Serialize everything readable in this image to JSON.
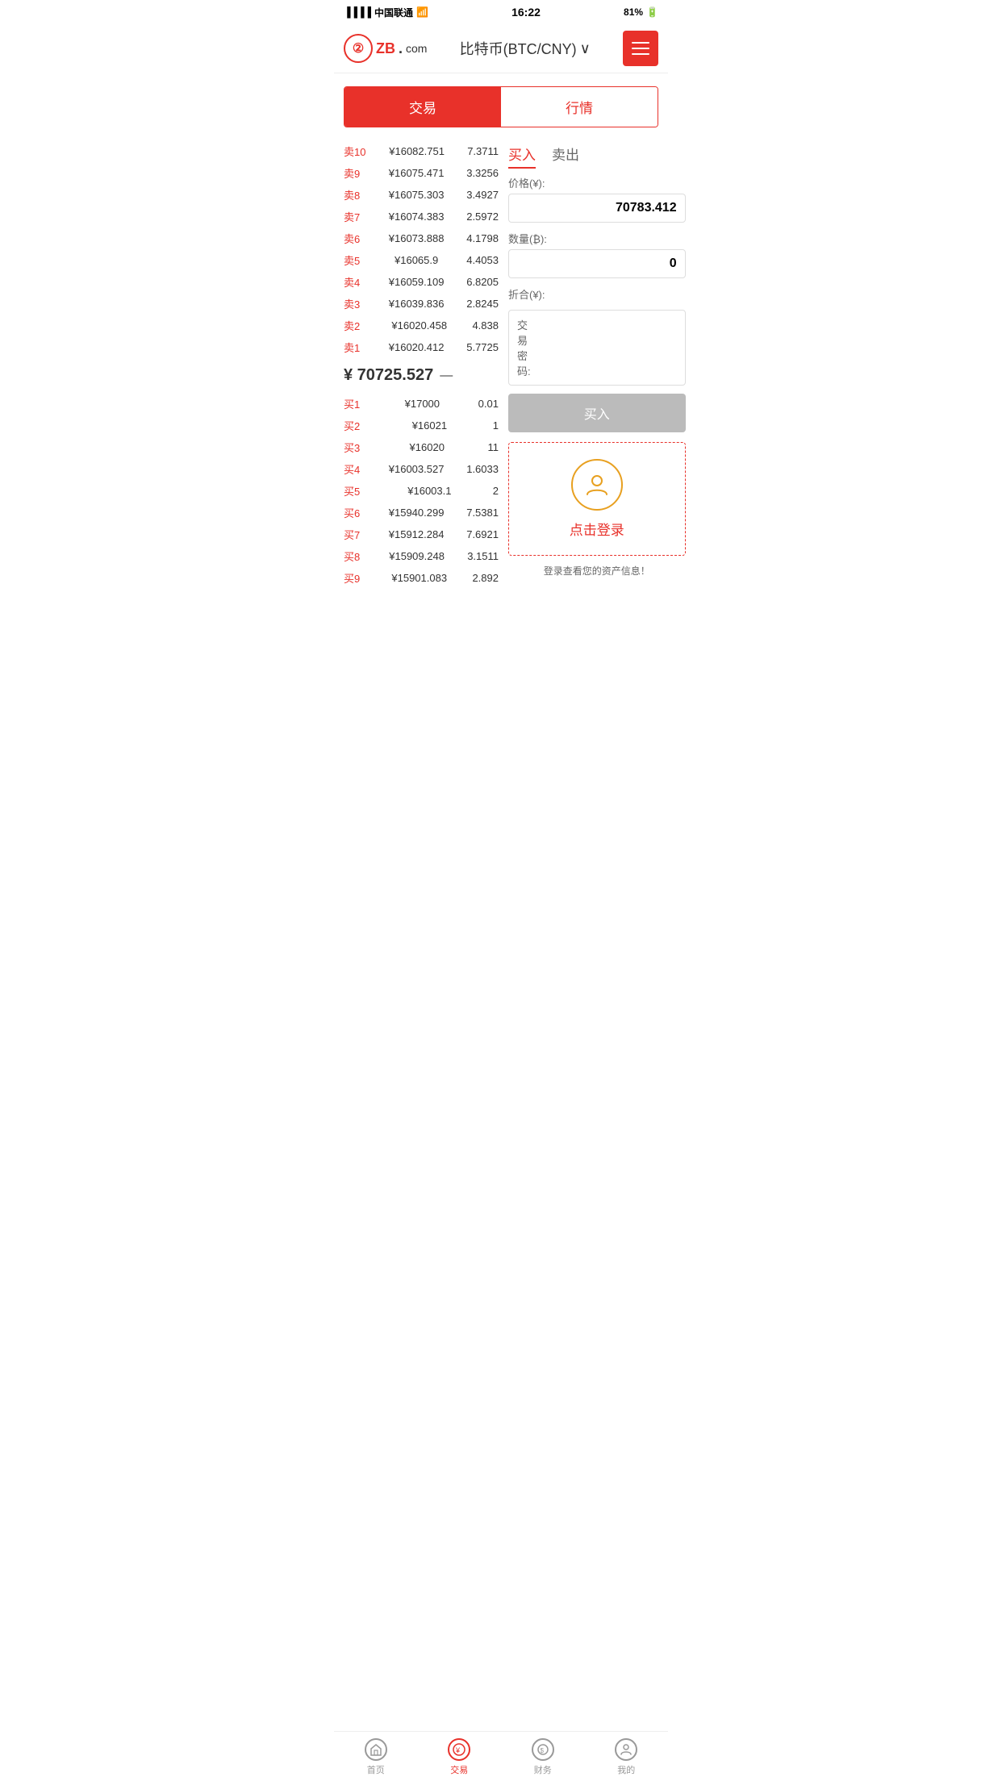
{
  "statusBar": {
    "carrier": "中国联通",
    "time": "16:22",
    "battery": "81%"
  },
  "header": {
    "title": "比特币(BTC/CNY)",
    "menuIcon": "≡"
  },
  "tabs": [
    {
      "id": "trade",
      "label": "交易",
      "active": true
    },
    {
      "id": "market",
      "label": "行情",
      "active": false
    }
  ],
  "orderBook": {
    "sellOrders": [
      {
        "label": "卖10",
        "price": "¥16082.751",
        "amount": "7.3711"
      },
      {
        "label": "卖9",
        "price": "¥16075.471",
        "amount": "3.3256"
      },
      {
        "label": "卖8",
        "price": "¥16075.303",
        "amount": "3.4927"
      },
      {
        "label": "卖7",
        "price": "¥16074.383",
        "amount": "2.5972"
      },
      {
        "label": "卖6",
        "price": "¥16073.888",
        "amount": "4.1798"
      },
      {
        "label": "卖5",
        "price": "¥16065.9",
        "amount": "4.4053"
      },
      {
        "label": "卖4",
        "price": "¥16059.109",
        "amount": "6.8205"
      },
      {
        "label": "卖3",
        "price": "¥16039.836",
        "amount": "2.8245"
      },
      {
        "label": "卖2",
        "price": "¥16020.458",
        "amount": "4.838"
      },
      {
        "label": "卖1",
        "price": "¥16020.412",
        "amount": "5.7725"
      }
    ],
    "midPrice": "¥ 70725.527",
    "midPriceIcon": "—",
    "buyOrders": [
      {
        "label": "买1",
        "price": "¥17000",
        "amount": "0.01"
      },
      {
        "label": "买2",
        "price": "¥16021",
        "amount": "1"
      },
      {
        "label": "买3",
        "price": "¥16020",
        "amount": "11"
      },
      {
        "label": "买4",
        "price": "¥16003.527",
        "amount": "1.6033"
      },
      {
        "label": "买5",
        "price": "¥16003.1",
        "amount": "2"
      },
      {
        "label": "买6",
        "price": "¥15940.299",
        "amount": "7.5381"
      },
      {
        "label": "买7",
        "price": "¥15912.284",
        "amount": "7.6921"
      },
      {
        "label": "买8",
        "price": "¥15909.248",
        "amount": "3.1511"
      },
      {
        "label": "买9",
        "price": "¥15901.083",
        "amount": "2.892"
      }
    ]
  },
  "tradePanel": {
    "buyTab": "买入",
    "sellTab": "卖出",
    "priceLabel": "价格(¥):",
    "priceValue": "70783.412",
    "quantityLabel": "数量(₿):",
    "quantityValue": "0",
    "totalLabel": "折合(¥):",
    "totalValue": "",
    "passwordLabel": "交易密码:",
    "buyButton": "买入",
    "loginAreaIcon": "👤",
    "loginText": "点击登录",
    "assetInfo": "登录查看您的资产信息！"
  },
  "bottomNav": [
    {
      "id": "home",
      "label": "首页",
      "icon": "☆",
      "active": false
    },
    {
      "id": "trade",
      "label": "交易",
      "icon": "¥",
      "active": true
    },
    {
      "id": "finance",
      "label": "财务",
      "icon": "💰",
      "active": false
    },
    {
      "id": "profile",
      "label": "我的",
      "icon": "👤",
      "active": false
    }
  ]
}
